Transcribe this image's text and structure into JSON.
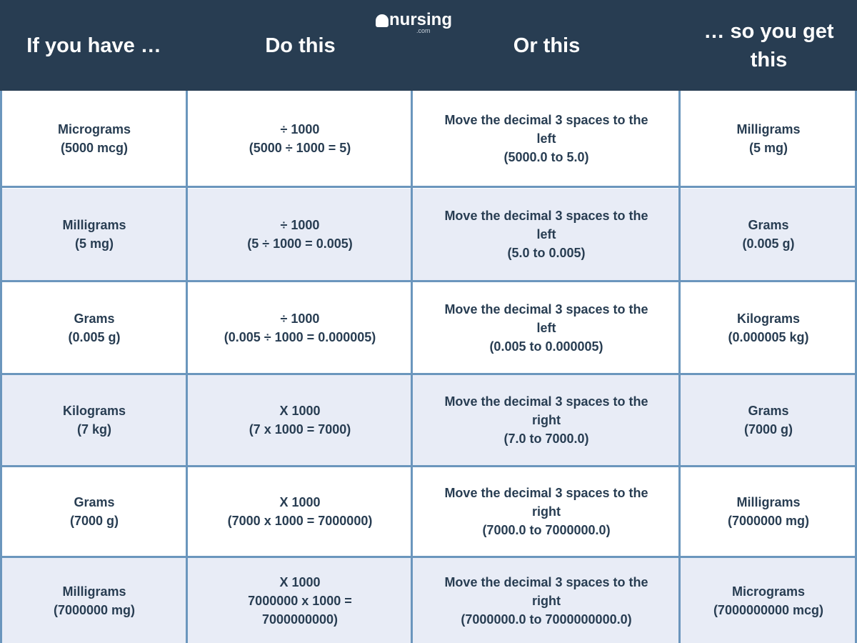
{
  "logo": {
    "text": "nursing",
    "suffix": ".com"
  },
  "header": {
    "columns": [
      "If you have …",
      "Do this",
      "Or this",
      "… so you get this"
    ]
  },
  "rows": [
    {
      "have": "Micrograms\n(5000 mcg)",
      "do": "÷ 1000\n(5000 ÷ 1000 = 5)",
      "or": "Move the decimal 3 spaces to the left\n(5000.0 to 5.0)",
      "get": "Milligrams\n(5 mg)"
    },
    {
      "have": "Milligrams\n(5 mg)",
      "do": "÷ 1000\n(5 ÷ 1000 = 0.005)",
      "or": "Move the decimal 3 spaces to the left\n(5.0 to 0.005)",
      "get": "Grams\n(0.005 g)"
    },
    {
      "have": "Grams\n(0.005 g)",
      "do": "÷ 1000\n(0.005 ÷ 1000 = 0.000005)",
      "or": "Move the decimal 3 spaces to the left\n(0.005 to 0.000005)",
      "get": "Kilograms\n(0.000005 kg)"
    },
    {
      "have": "Kilograms\n(7 kg)",
      "do": "X 1000\n(7 x 1000 = 7000)",
      "or": "Move the decimal 3 spaces to the right\n(7.0 to 7000.0)",
      "get": "Grams\n(7000 g)"
    },
    {
      "have": "Grams\n(7000 g)",
      "do": "X 1000\n(7000 x 1000 = 7000000)",
      "or": "Move the decimal 3 spaces to the right\n(7000.0 to 7000000.0)",
      "get": "Milligrams\n(7000000 mg)"
    },
    {
      "have": "Milligrams\n(7000000 mg)",
      "do": "X 1000\n7000000 x 1000 =\n7000000000)",
      "or": "Move the decimal 3 spaces to the right\n(7000000.0 to 7000000000.0)",
      "get": "Micrograms\n(7000000000 mcg)"
    }
  ]
}
